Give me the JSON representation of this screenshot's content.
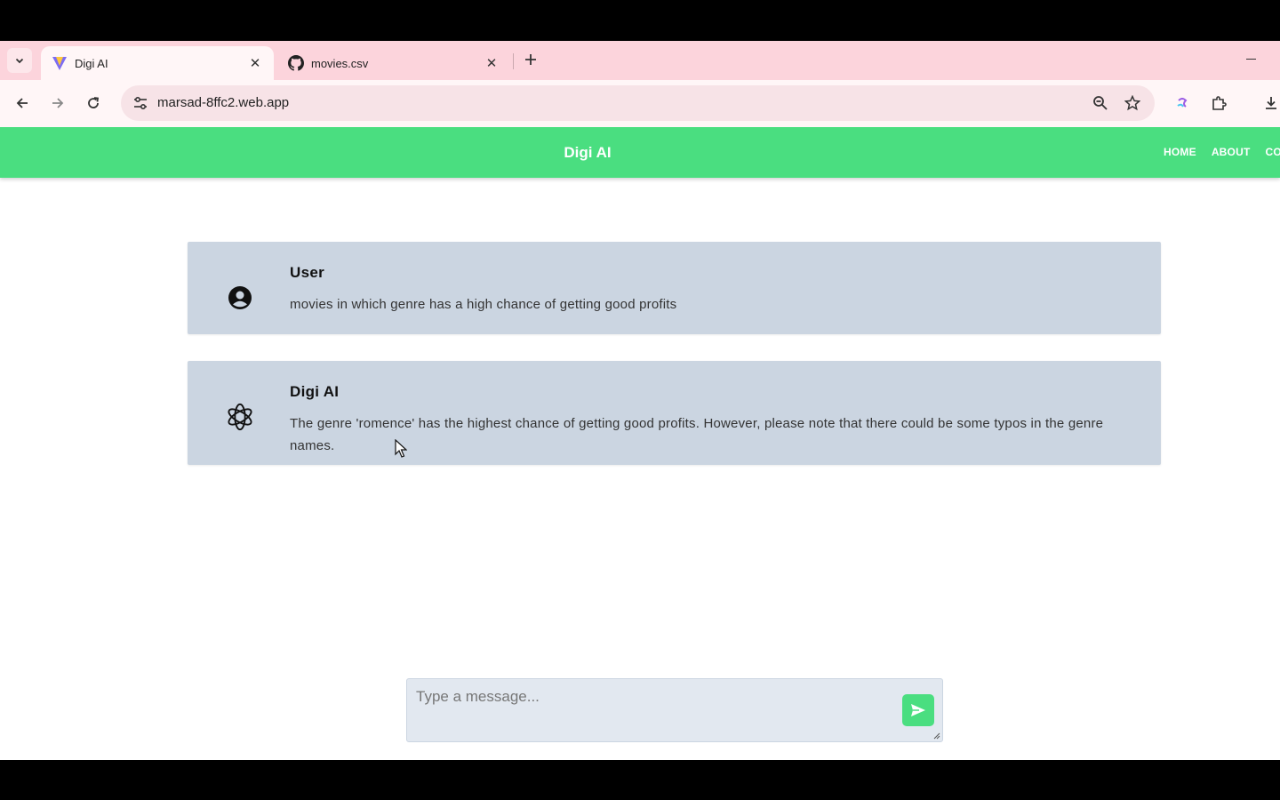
{
  "browser": {
    "tabs": [
      {
        "title": "Digi AI",
        "active": true,
        "favicon": "vite-icon"
      },
      {
        "title": "movies.csv",
        "active": false,
        "favicon": "github-icon"
      }
    ],
    "url": "marsad-8ffc2.web.app"
  },
  "app": {
    "brand": "Digi AI",
    "nav": [
      "HOME",
      "ABOUT",
      "CO"
    ],
    "accent_color": "#4ade80",
    "messages": [
      {
        "sender": "User",
        "avatar": "user-circle-icon",
        "text": "movies in which genre has a high chance of getting good profits"
      },
      {
        "sender": "Digi AI",
        "avatar": "openai-icon",
        "text": "The genre 'romence' has the highest chance of getting good profits. However, please note that there could be some typos in the genre names."
      }
    ],
    "composer": {
      "placeholder": "Type a message...",
      "send_icon": "send-icon"
    }
  }
}
